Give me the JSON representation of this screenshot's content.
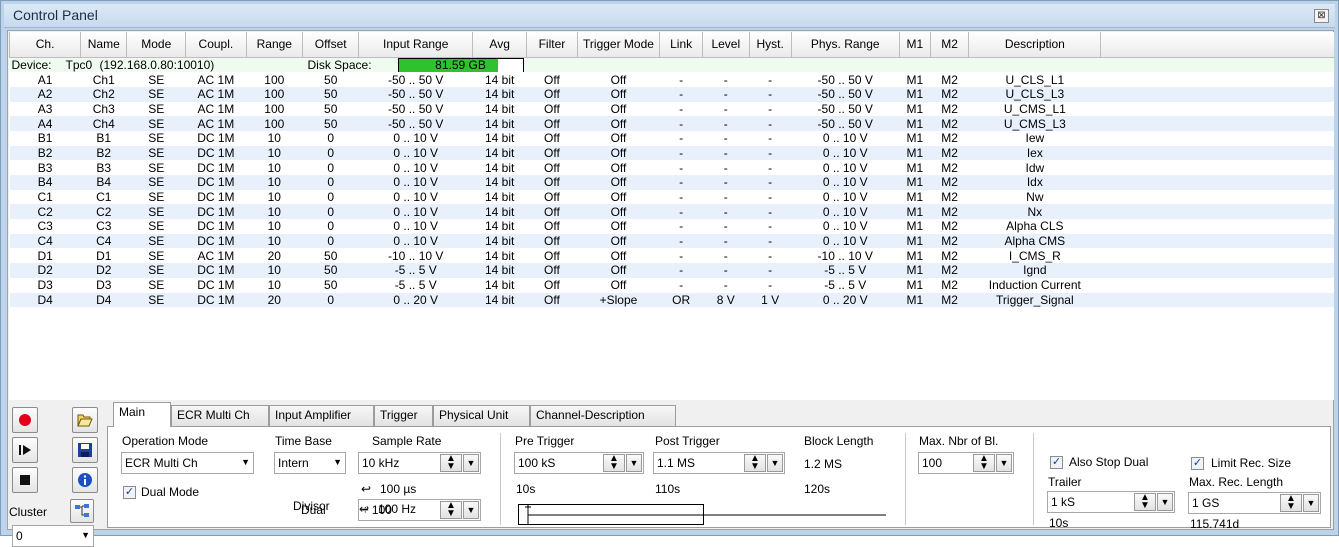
{
  "window": {
    "title": "Control Panel",
    "close_glyph": "⊠"
  },
  "table": {
    "columns": [
      "Ch.",
      "Name",
      "Mode",
      "Coupl.",
      "Range",
      "Offset",
      "Input Range",
      "Avg",
      "Filter",
      "Trigger Mode",
      "Link",
      "Level",
      "Hyst.",
      "Phys. Range",
      "M1",
      "M2",
      "Description"
    ],
    "device": {
      "label": "Device:",
      "name": "Tpc0",
      "address": "(192.168.0.80:10010)",
      "disk_label": "Disk Space:",
      "disk_value": "81.59 GB",
      "disk_fill_fraction": 0.8
    },
    "rows": [
      [
        "A1",
        "Ch1",
        "SE",
        "AC 1M",
        "100",
        "50",
        "-50 .. 50 V",
        "14 bit",
        "Off",
        "Off",
        "-",
        "-",
        "-",
        "-50 .. 50  V",
        "M1",
        "M2",
        "U_CLS_L1"
      ],
      [
        "A2",
        "Ch2",
        "SE",
        "AC 1M",
        "100",
        "50",
        "-50 .. 50 V",
        "14 bit",
        "Off",
        "Off",
        "-",
        "-",
        "-",
        "-50 .. 50  V",
        "M1",
        "M2",
        "U_CLS_L3"
      ],
      [
        "A3",
        "Ch3",
        "SE",
        "AC 1M",
        "100",
        "50",
        "-50 .. 50 V",
        "14 bit",
        "Off",
        "Off",
        "-",
        "-",
        "-",
        "-50 .. 50  V",
        "M1",
        "M2",
        "U_CMS_L1"
      ],
      [
        "A4",
        "Ch4",
        "SE",
        "AC 1M",
        "100",
        "50",
        "-50 .. 50 V",
        "14 bit",
        "Off",
        "Off",
        "-",
        "-",
        "-",
        "-50 .. 50  V",
        "M1",
        "M2",
        "U_CMS_L3"
      ],
      [
        "B1",
        "B1",
        "SE",
        "DC 1M",
        "10",
        "0",
        "0 .. 10 V",
        "14 bit",
        "Off",
        "Off",
        "-",
        "-",
        "-",
        "0 .. 10  V",
        "M1",
        "M2",
        "Iew"
      ],
      [
        "B2",
        "B2",
        "SE",
        "DC 1M",
        "10",
        "0",
        "0 .. 10 V",
        "14 bit",
        "Off",
        "Off",
        "-",
        "-",
        "-",
        "0 .. 10  V",
        "M1",
        "M2",
        "Iex"
      ],
      [
        "B3",
        "B3",
        "SE",
        "DC 1M",
        "10",
        "0",
        "0 .. 10 V",
        "14 bit",
        "Off",
        "Off",
        "-",
        "-",
        "-",
        "0 .. 10  V",
        "M1",
        "M2",
        "Idw"
      ],
      [
        "B4",
        "B4",
        "SE",
        "DC 1M",
        "10",
        "0",
        "0 .. 10 V",
        "14 bit",
        "Off",
        "Off",
        "-",
        "-",
        "-",
        "0 .. 10  V",
        "M1",
        "M2",
        "Idx"
      ],
      [
        "C1",
        "C1",
        "SE",
        "DC 1M",
        "10",
        "0",
        "0 .. 10 V",
        "14 bit",
        "Off",
        "Off",
        "-",
        "-",
        "-",
        "0 .. 10  V",
        "M1",
        "M2",
        "Nw"
      ],
      [
        "C2",
        "C2",
        "SE",
        "DC 1M",
        "10",
        "0",
        "0 .. 10 V",
        "14 bit",
        "Off",
        "Off",
        "-",
        "-",
        "-",
        "0 .. 10  V",
        "M1",
        "M2",
        "Nx"
      ],
      [
        "C3",
        "C3",
        "SE",
        "DC 1M",
        "10",
        "0",
        "0 .. 10 V",
        "14 bit",
        "Off",
        "Off",
        "-",
        "-",
        "-",
        "0 .. 10  V",
        "M1",
        "M2",
        "Alpha CLS"
      ],
      [
        "C4",
        "C4",
        "SE",
        "DC 1M",
        "10",
        "0",
        "0 .. 10 V",
        "14 bit",
        "Off",
        "Off",
        "-",
        "-",
        "-",
        "0 .. 10  V",
        "M1",
        "M2",
        "Alpha CMS"
      ],
      [
        "D1",
        "D1",
        "SE",
        "AC 1M",
        "20",
        "50",
        "-10 .. 10 V",
        "14 bit",
        "Off",
        "Off",
        "-",
        "-",
        "-",
        "-10 .. 10  V",
        "M1",
        "M2",
        "I_CMS_R"
      ],
      [
        "D2",
        "D2",
        "SE",
        "DC 1M",
        "10",
        "50",
        "-5 .. 5 V",
        "14 bit",
        "Off",
        "Off",
        "-",
        "-",
        "-",
        "-5 .. 5  V",
        "M1",
        "M2",
        "Ignd"
      ],
      [
        "D3",
        "D3",
        "SE",
        "DC 1M",
        "10",
        "50",
        "-5 .. 5 V",
        "14 bit",
        "Off",
        "Off",
        "-",
        "-",
        "-",
        "-5 .. 5  V",
        "M1",
        "M2",
        "Induction Current"
      ],
      [
        "D4",
        "D4",
        "SE",
        "DC 1M",
        "20",
        "0",
        "0 .. 20 V",
        "14 bit",
        "Off",
        "+Slope",
        "OR",
        "8 V",
        "1 V",
        "0 .. 20  V",
        "M1",
        "M2",
        "Trigger_Signal"
      ]
    ]
  },
  "toolbar": {
    "cluster_label": "Cluster",
    "cluster_value": "0"
  },
  "tabs": [
    "Main",
    "ECR Multi Ch",
    "Input Amplifier",
    "Trigger",
    "Physical Unit",
    "Channel-Description"
  ],
  "main": {
    "operation_mode_label": "Operation Mode",
    "operation_mode_value": "ECR Multi Ch",
    "dual_mode_label": "Dual Mode",
    "time_base_label": "Time Base",
    "time_base_value": "Intern",
    "sample_rate_label": "Sample Rate",
    "sample_rate_value": "10 kHz",
    "sample_period": "100 µs",
    "dual_divisor_label1": "Dual",
    "dual_divisor_label2": "Divisor",
    "dual_divisor_value": "÷ 100",
    "dual_freq": "100 Hz",
    "pre_trigger_label": "Pre Trigger",
    "pre_trigger_value": "100 kS",
    "pre_trigger_time": "10s",
    "post_trigger_label": "Post Trigger",
    "post_trigger_value": "1.1 MS",
    "post_trigger_time": "110s",
    "block_length_label": "Block Length",
    "block_length_value": "1.2 MS",
    "block_length_time": "120s",
    "max_blocks_label": "Max. Nbr of Bl.",
    "max_blocks_value": "100",
    "also_stop_dual_label": "Also Stop Dual",
    "trailer_label": "Trailer",
    "trailer_value": "1 kS",
    "trailer_time": "10s",
    "limit_rec_label": "Limit Rec. Size",
    "max_rec_label": "Max. Rec. Length",
    "max_rec_value": "1 GS",
    "max_rec_time": "115.741d"
  }
}
